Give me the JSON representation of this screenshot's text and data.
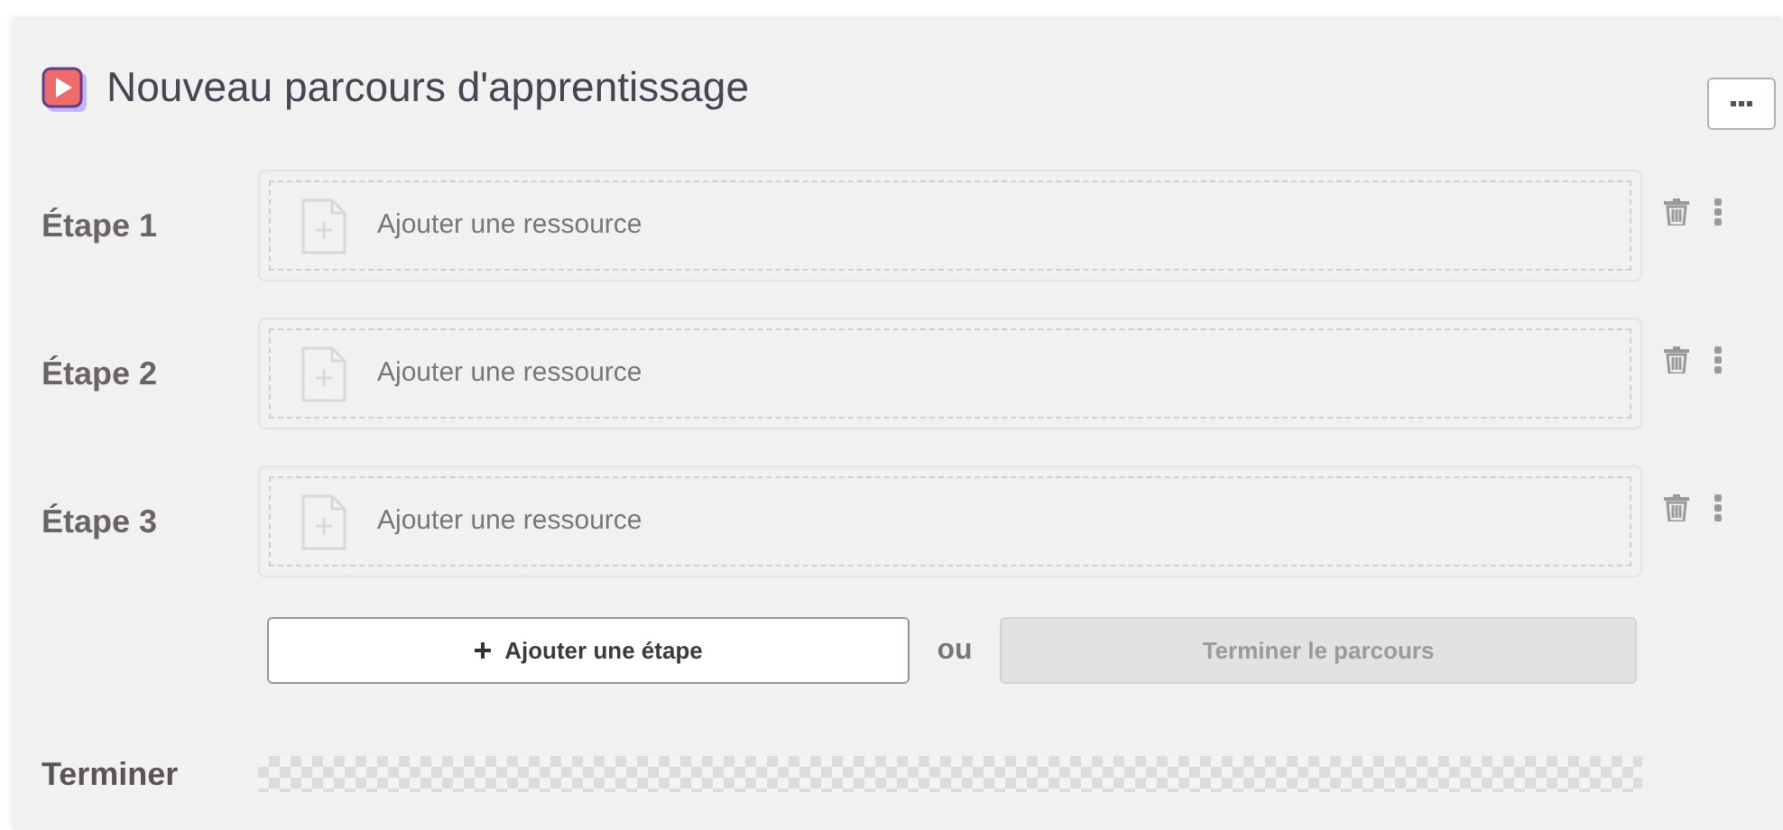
{
  "header": {
    "title": "Nouveau parcours d'apprentissage"
  },
  "steps": [
    {
      "label": "Étape 1",
      "placeholder": "Ajouter une ressource"
    },
    {
      "label": "Étape 2",
      "placeholder": "Ajouter une ressource"
    },
    {
      "label": "Étape 3",
      "placeholder": "Ajouter une ressource"
    }
  ],
  "actions": {
    "add_step": "Ajouter une étape",
    "separator": "ou",
    "finish": {
      "label": "Terminer le parcours",
      "disabled": true
    }
  },
  "end_section": {
    "label": "Terminer"
  }
}
